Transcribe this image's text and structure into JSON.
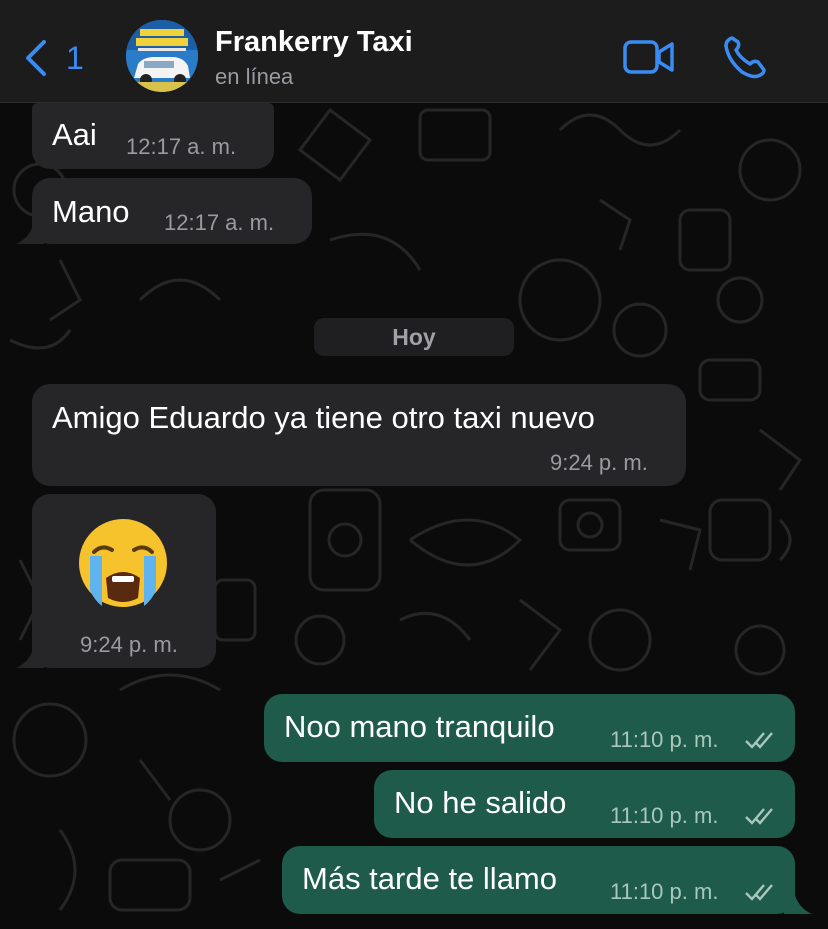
{
  "header": {
    "back_count": "1",
    "contact_name": "Frankerry Taxi",
    "status": "en línea",
    "avatar_text_line1": "ESTAMOS",
    "avatar_text_line2": "DISPONIBLES"
  },
  "date_separator": "Hoy",
  "messages": [
    {
      "direction": "incoming",
      "text": "Aai",
      "time": "12:17 a. m."
    },
    {
      "direction": "incoming",
      "text": "Mano",
      "time": "12:17 a. m."
    },
    {
      "direction": "incoming",
      "text": "Amigo Eduardo ya tiene otro taxi nuevo",
      "time": "9:24 p. m."
    },
    {
      "direction": "incoming",
      "text": "😭",
      "time": "9:24 p. m."
    },
    {
      "direction": "outgoing",
      "text": "Noo mano tranquilo",
      "time": "11:10 p. m."
    },
    {
      "direction": "outgoing",
      "text": "No he salido",
      "time": "11:10 p. m."
    },
    {
      "direction": "outgoing",
      "text": "Más tarde te llamo",
      "time": "11:10 p. m."
    }
  ],
  "icons": {
    "back": "chevron-left-icon",
    "video": "video-camera-icon",
    "call": "phone-icon",
    "read": "double-check-icon"
  },
  "colors": {
    "accent": "#3a8cf3",
    "incoming_bubble": "#262628",
    "outgoing_bubble": "#1e5b4a",
    "background": "#0b0b0b"
  }
}
